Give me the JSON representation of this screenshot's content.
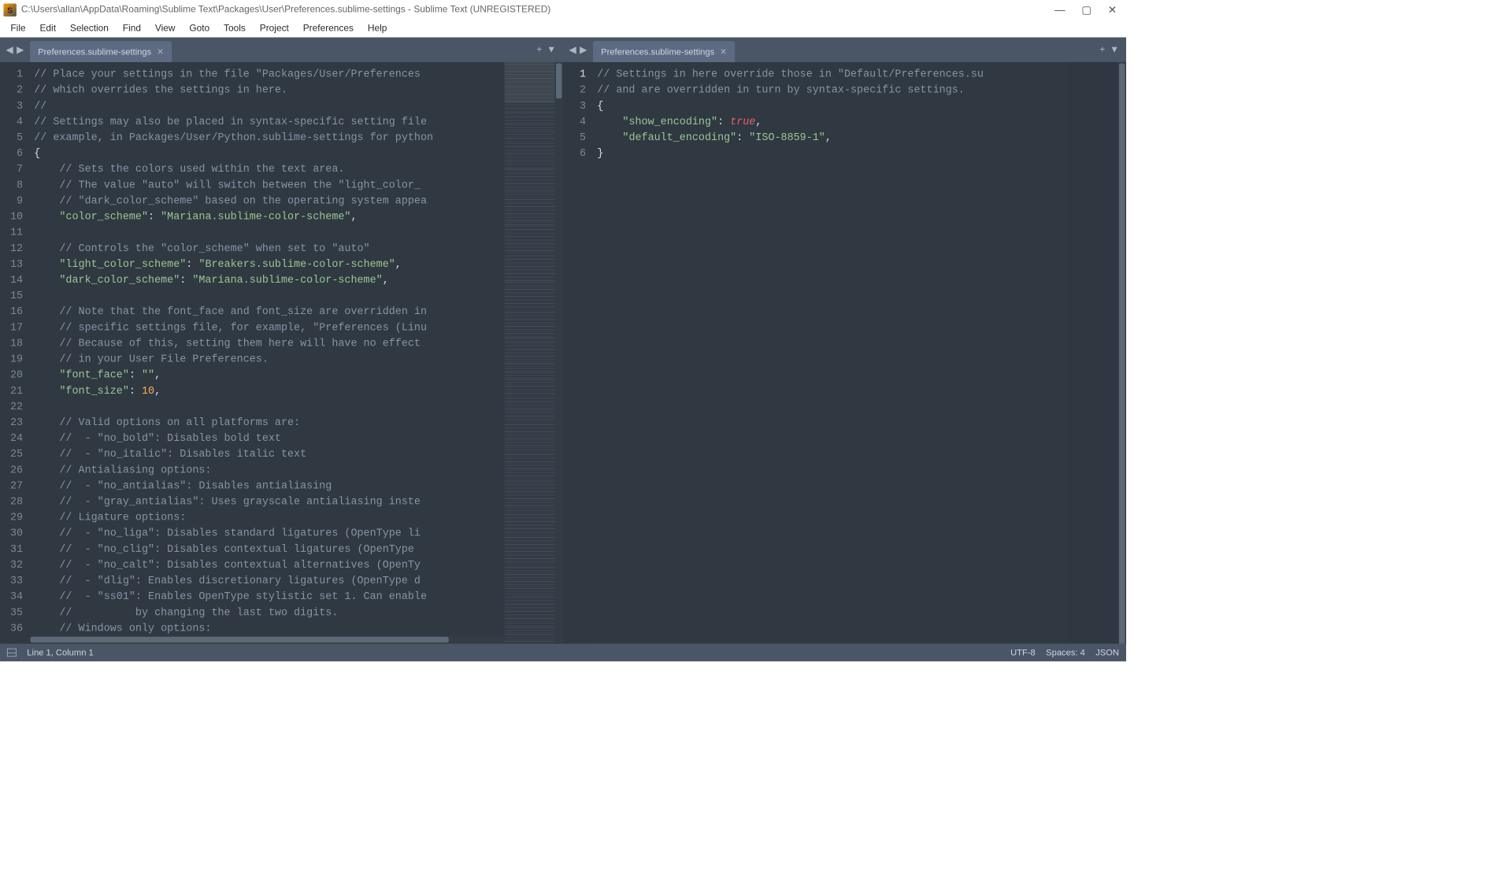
{
  "window": {
    "title": "C:\\Users\\allan\\AppData\\Roaming\\Sublime Text\\Packages\\User\\Preferences.sublime-settings - Sublime Text (UNREGISTERED)",
    "app_initial": "S"
  },
  "menu": {
    "file": "File",
    "edit": "Edit",
    "selection": "Selection",
    "find": "Find",
    "view": "View",
    "goto": "Goto",
    "tools": "Tools",
    "project": "Project",
    "preferences": "Preferences",
    "help": "Help"
  },
  "panes": {
    "left": {
      "tab_label": "Preferences.sublime-settings",
      "lines": [
        {
          "n": 1,
          "tokens": [
            [
              "comment",
              "// Place your settings in the file \"Packages/User/Preferences"
            ]
          ]
        },
        {
          "n": 2,
          "tokens": [
            [
              "comment",
              "// which overrides the settings in here."
            ]
          ]
        },
        {
          "n": 3,
          "tokens": [
            [
              "comment",
              "//"
            ]
          ]
        },
        {
          "n": 4,
          "tokens": [
            [
              "comment",
              "// Settings may also be placed in syntax-specific setting file"
            ]
          ]
        },
        {
          "n": 5,
          "tokens": [
            [
              "comment",
              "// example, in Packages/User/Python.sublime-settings for python"
            ]
          ]
        },
        {
          "n": 6,
          "tokens": [
            [
              "punc",
              "{"
            ]
          ]
        },
        {
          "n": 7,
          "tokens": [
            [
              "indent",
              "    "
            ],
            [
              "comment",
              "// Sets the colors used within the text area."
            ]
          ]
        },
        {
          "n": 8,
          "tokens": [
            [
              "indent",
              "    "
            ],
            [
              "comment",
              "// The value \"auto\" will switch between the \"light_color_"
            ]
          ]
        },
        {
          "n": 9,
          "tokens": [
            [
              "indent",
              "    "
            ],
            [
              "comment",
              "// \"dark_color_scheme\" based on the operating system appea"
            ]
          ]
        },
        {
          "n": 10,
          "tokens": [
            [
              "indent",
              "    "
            ],
            [
              "key",
              "\"color_scheme\""
            ],
            [
              "punc",
              ": "
            ],
            [
              "string",
              "\"Mariana.sublime-color-scheme\""
            ],
            [
              "punc",
              ","
            ]
          ]
        },
        {
          "n": 11,
          "tokens": [
            [
              "plain",
              ""
            ]
          ]
        },
        {
          "n": 12,
          "tokens": [
            [
              "indent",
              "    "
            ],
            [
              "comment",
              "// Controls the \"color_scheme\" when set to \"auto\""
            ]
          ]
        },
        {
          "n": 13,
          "tokens": [
            [
              "indent",
              "    "
            ],
            [
              "key",
              "\"light_color_scheme\""
            ],
            [
              "punc",
              ": "
            ],
            [
              "string",
              "\"Breakers.sublime-color-scheme\""
            ],
            [
              "punc",
              ","
            ]
          ]
        },
        {
          "n": 14,
          "tokens": [
            [
              "indent",
              "    "
            ],
            [
              "key",
              "\"dark_color_scheme\""
            ],
            [
              "punc",
              ": "
            ],
            [
              "string",
              "\"Mariana.sublime-color-scheme\""
            ],
            [
              "punc",
              ","
            ]
          ]
        },
        {
          "n": 15,
          "tokens": [
            [
              "plain",
              ""
            ]
          ]
        },
        {
          "n": 16,
          "tokens": [
            [
              "indent",
              "    "
            ],
            [
              "comment",
              "// Note that the font_face and font_size are overridden in"
            ]
          ]
        },
        {
          "n": 17,
          "tokens": [
            [
              "indent",
              "    "
            ],
            [
              "comment",
              "// specific settings file, for example, \"Preferences (Linu"
            ]
          ]
        },
        {
          "n": 18,
          "tokens": [
            [
              "indent",
              "    "
            ],
            [
              "comment",
              "// Because of this, setting them here will have no effect"
            ]
          ]
        },
        {
          "n": 19,
          "tokens": [
            [
              "indent",
              "    "
            ],
            [
              "comment",
              "// in your User File Preferences."
            ]
          ]
        },
        {
          "n": 20,
          "tokens": [
            [
              "indent",
              "    "
            ],
            [
              "key",
              "\"font_face\""
            ],
            [
              "punc",
              ": "
            ],
            [
              "string",
              "\"\""
            ],
            [
              "punc",
              ","
            ]
          ]
        },
        {
          "n": 21,
          "tokens": [
            [
              "indent",
              "    "
            ],
            [
              "key",
              "\"font_size\""
            ],
            [
              "punc",
              ": "
            ],
            [
              "num",
              "10"
            ],
            [
              "punc",
              ","
            ]
          ]
        },
        {
          "n": 22,
          "tokens": [
            [
              "plain",
              ""
            ]
          ]
        },
        {
          "n": 23,
          "tokens": [
            [
              "indent",
              "    "
            ],
            [
              "comment",
              "// Valid options on all platforms are:"
            ]
          ]
        },
        {
          "n": 24,
          "tokens": [
            [
              "indent",
              "    "
            ],
            [
              "comment",
              "//  - \"no_bold\": Disables bold text"
            ]
          ]
        },
        {
          "n": 25,
          "tokens": [
            [
              "indent",
              "    "
            ],
            [
              "comment",
              "//  - \"no_italic\": Disables italic text"
            ]
          ]
        },
        {
          "n": 26,
          "tokens": [
            [
              "indent",
              "    "
            ],
            [
              "comment",
              "// Antialiasing options:"
            ]
          ]
        },
        {
          "n": 27,
          "tokens": [
            [
              "indent",
              "    "
            ],
            [
              "comment",
              "//  - \"no_antialias\": Disables antialiasing"
            ]
          ]
        },
        {
          "n": 28,
          "tokens": [
            [
              "indent",
              "    "
            ],
            [
              "comment",
              "//  - \"gray_antialias\": Uses grayscale antialiasing inste"
            ]
          ]
        },
        {
          "n": 29,
          "tokens": [
            [
              "indent",
              "    "
            ],
            [
              "comment",
              "// Ligature options:"
            ]
          ]
        },
        {
          "n": 30,
          "tokens": [
            [
              "indent",
              "    "
            ],
            [
              "comment",
              "//  - \"no_liga\": Disables standard ligatures (OpenType li"
            ]
          ]
        },
        {
          "n": 31,
          "tokens": [
            [
              "indent",
              "    "
            ],
            [
              "comment",
              "//  - \"no_clig\": Disables contextual ligatures (OpenType "
            ]
          ]
        },
        {
          "n": 32,
          "tokens": [
            [
              "indent",
              "    "
            ],
            [
              "comment",
              "//  - \"no_calt\": Disables contextual alternatives (OpenTy"
            ]
          ]
        },
        {
          "n": 33,
          "tokens": [
            [
              "indent",
              "    "
            ],
            [
              "comment",
              "//  - \"dlig\": Enables discretionary ligatures (OpenType d"
            ]
          ]
        },
        {
          "n": 34,
          "tokens": [
            [
              "indent",
              "    "
            ],
            [
              "comment",
              "//  - \"ss01\": Enables OpenType stylistic set 1. Can enable"
            ]
          ]
        },
        {
          "n": 35,
          "tokens": [
            [
              "indent",
              "    "
            ],
            [
              "comment",
              "//          by changing the last two digits."
            ]
          ]
        },
        {
          "n": 36,
          "tokens": [
            [
              "indent",
              "    "
            ],
            [
              "comment",
              "// Windows only options:"
            ]
          ]
        }
      ]
    },
    "right": {
      "tab_label": "Preferences.sublime-settings",
      "lines": [
        {
          "n": 1,
          "active": true,
          "tokens": [
            [
              "comment",
              "// Settings in here override those in \"Default/Preferences.su"
            ]
          ]
        },
        {
          "n": 2,
          "tokens": [
            [
              "comment",
              "// and are overridden in turn by syntax-specific settings."
            ]
          ]
        },
        {
          "n": 3,
          "tokens": [
            [
              "punc",
              "{"
            ]
          ]
        },
        {
          "n": 4,
          "tokens": [
            [
              "indent",
              "    "
            ],
            [
              "key",
              "\"show_encoding\""
            ],
            [
              "punc",
              ": "
            ],
            [
              "bool",
              "true"
            ],
            [
              "punc",
              ","
            ]
          ]
        },
        {
          "n": 5,
          "tokens": [
            [
              "indent",
              "    "
            ],
            [
              "key",
              "\"default_encoding\""
            ],
            [
              "punc",
              ": "
            ],
            [
              "string",
              "\"ISO-8859-1\""
            ],
            [
              "punc",
              ","
            ]
          ]
        },
        {
          "n": 6,
          "tokens": [
            [
              "punc",
              "}"
            ]
          ]
        }
      ]
    }
  },
  "status": {
    "cursor": "Line 1, Column 1",
    "encoding": "UTF-8",
    "indent": "Spaces: 4",
    "syntax": "JSON"
  }
}
